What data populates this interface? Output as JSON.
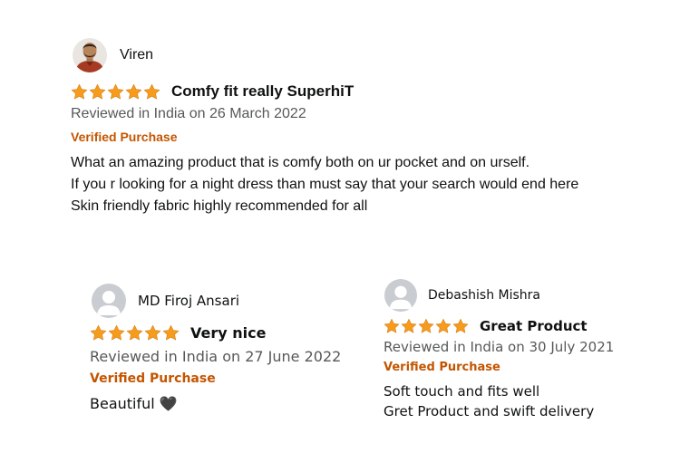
{
  "colors": {
    "star": "#f79b1c",
    "verified": "#c45500",
    "meta": "#565959",
    "text": "#0f1111"
  },
  "reviews": [
    {
      "reviewer": "Viren",
      "avatar_icon": "user-photo-avatar",
      "rating": 5,
      "title": "Comfy fit really SuperhiT",
      "date_line": "Reviewed in India on 26 March 2022",
      "badge": "Verified Purchase",
      "body": [
        "What an amazing product that is comfy both on ur pocket and on urself.",
        "If you r looking for a night dress than must say that your search would end here",
        "Skin friendly fabric highly recommended for all"
      ]
    },
    {
      "reviewer": "MD Firoj Ansari",
      "avatar_icon": "default-user-avatar-icon",
      "rating": 5,
      "title": "Very nice",
      "date_line": "Reviewed in India on 27 June 2022",
      "badge": "Verified Purchase",
      "body": [
        "Beautiful 🖤"
      ]
    },
    {
      "reviewer": "Debashish Mishra",
      "avatar_icon": "default-user-avatar-icon",
      "rating": 5,
      "title": "Great Product",
      "date_line": "Reviewed in India on 30 July 2021",
      "badge": "Verified Purchase",
      "body": [
        "Soft touch and fits well",
        "Gret Product and swift delivery"
      ]
    }
  ]
}
